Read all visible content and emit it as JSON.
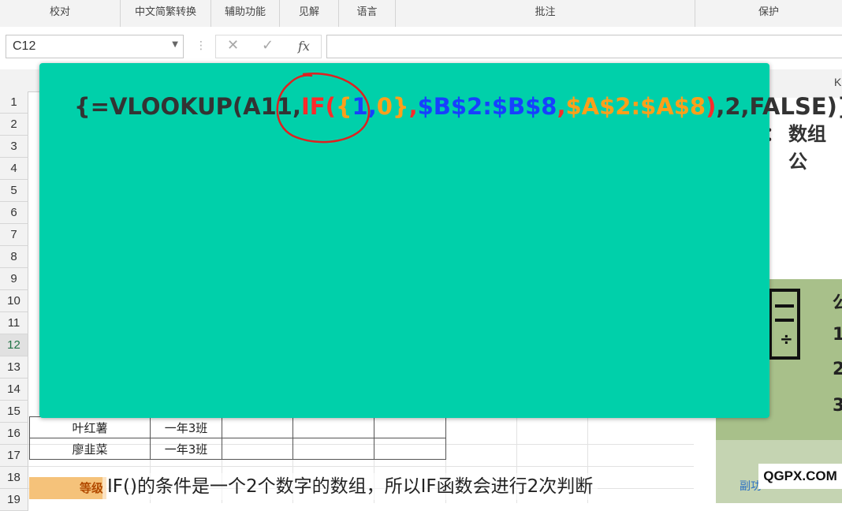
{
  "ribbon": {
    "groups": [
      {
        "label": "校对"
      },
      {
        "label": "中文简繁转换"
      },
      {
        "label": "辅助功能"
      },
      {
        "label": "见解"
      },
      {
        "label": "语言"
      },
      {
        "label": "批注"
      },
      {
        "label": "保护"
      }
    ]
  },
  "formula_bar": {
    "name_box": "C12",
    "cancel_symbol": "✕",
    "enter_symbol": "✓",
    "fx_symbol": "fx",
    "dots": "⋮",
    "formula_value": ""
  },
  "grid": {
    "rows": [
      "1",
      "2",
      "3",
      "4",
      "5",
      "6",
      "7",
      "8",
      "9",
      "10",
      "11",
      "12",
      "13",
      "14",
      "15",
      "16",
      "17",
      "18",
      "19"
    ],
    "selected_row": "12",
    "highlighted_row": "10",
    "visible_cells": {
      "r16_name": "叶红薯",
      "r16_class": "一年3班",
      "r17_name": "廖韭菜",
      "r17_class": "一年3班",
      "r19_grade": "等级"
    }
  },
  "right_panel": {
    "column_label": "K",
    "title": "数组公",
    "title_colon": "：",
    "green_heading": "公",
    "list_numbers": [
      "1",
      "2",
      "3"
    ],
    "copy_text": "副功"
  },
  "overlay": {
    "formula_parts": [
      {
        "text": "{=VLOOKUP(A11,",
        "color": "#333333"
      },
      {
        "text": "IF(",
        "color": "#ff2a2a"
      },
      {
        "text": "{",
        "color": "#ff9f1a"
      },
      {
        "text": "1",
        "color": "#1740ff"
      },
      {
        "text": ",",
        "color": "#1740ff"
      },
      {
        "text": "0",
        "color": "#ff9f1a"
      },
      {
        "text": "}",
        "color": "#ff9f1a"
      },
      {
        "text": ",",
        "color": "#ff2a2a"
      },
      {
        "text": "$B$2:$B$8",
        "color": "#1740ff"
      },
      {
        "text": ",",
        "color": "#ff2a2a"
      },
      {
        "text": "$A$2:$A$8",
        "color": "#ff9f1a"
      },
      {
        "text": ")",
        "color": "#ff2a2a"
      },
      {
        "text": ",2,FALSE)}",
        "color": "#333333"
      }
    ],
    "card_color": "#00d0aa",
    "annotation_color": "#e02020"
  },
  "subtitle": "IF()的条件是一个2个数字的数组，所以IF函数会进行2次判断",
  "watermark": "QGPX.COM"
}
